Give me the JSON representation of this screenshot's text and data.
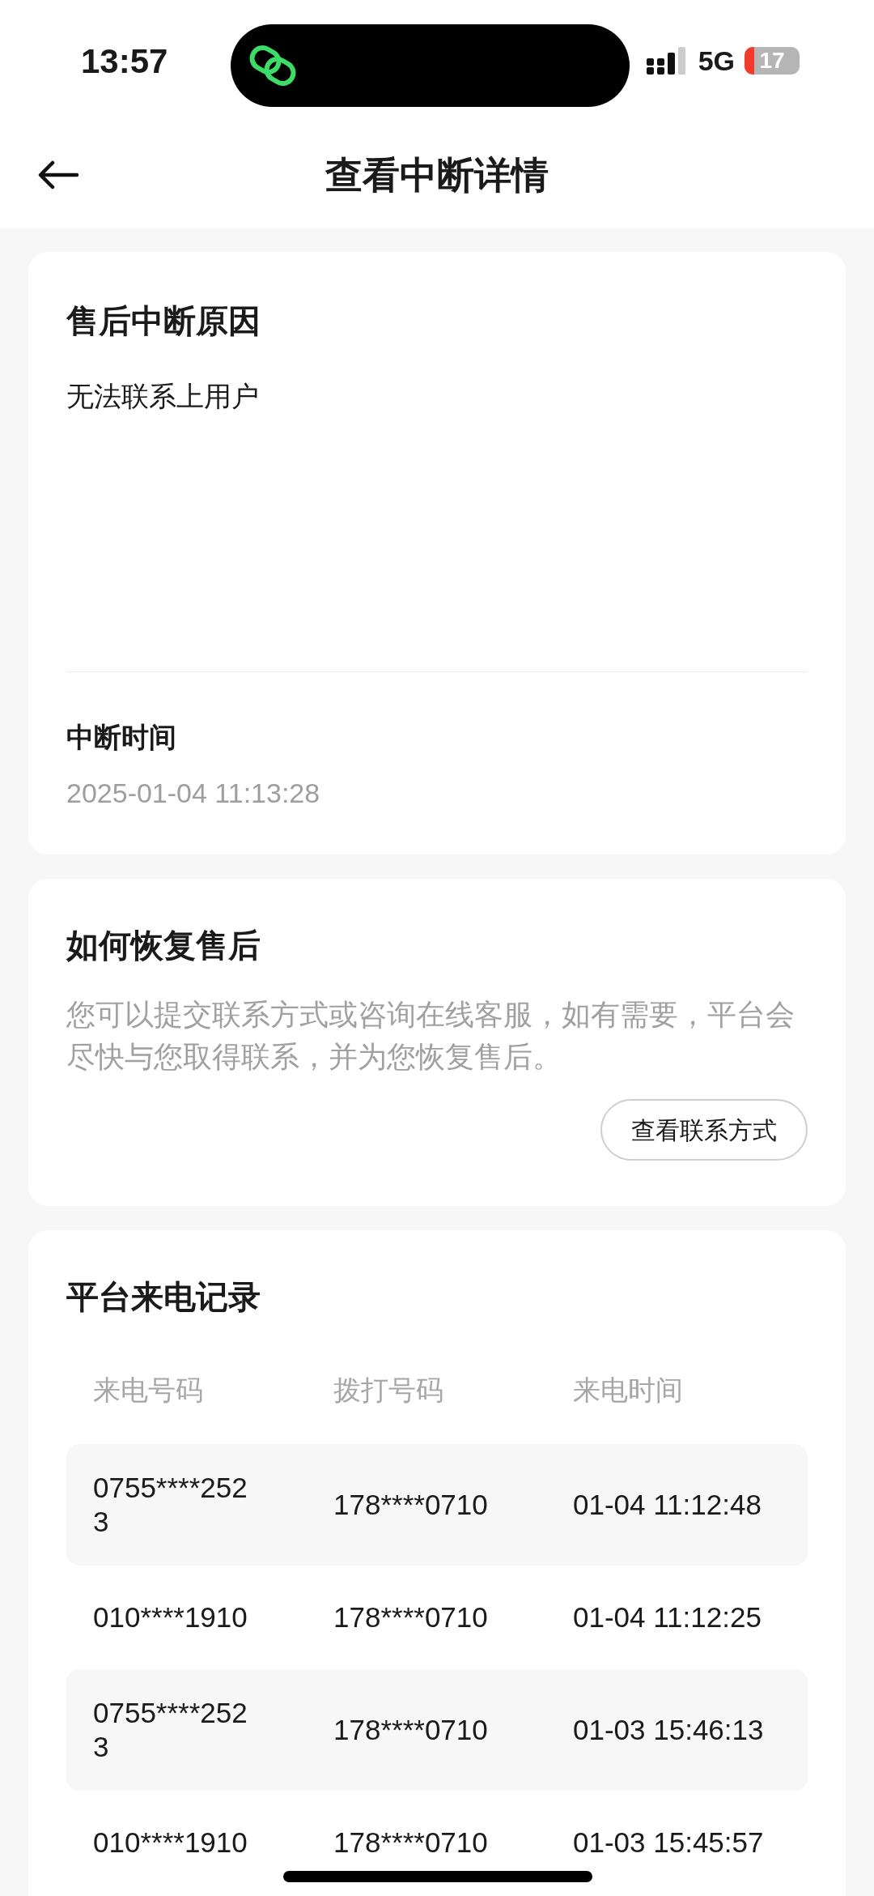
{
  "status_bar": {
    "time": "13:57",
    "network": "5G",
    "battery": "17"
  },
  "header": {
    "title": "查看中断详情"
  },
  "reason_card": {
    "title": "售后中断原因",
    "reason": "无法联系上用户",
    "time_label": "中断时间",
    "time_value": "2025-01-04 11:13:28"
  },
  "recover_card": {
    "title": "如何恢复售后",
    "description": "您可以提交联系方式或咨询在线客服，如有需要，平台会尽快与您取得联系，并为您恢复售后。",
    "button": "查看联系方式"
  },
  "calls_card": {
    "title": "平台来电记录",
    "columns": [
      "来电号码",
      "拨打号码",
      "来电时间"
    ],
    "rows": [
      {
        "caller": "0755****2523",
        "dialed": "178****0710",
        "time": "01-04 11:12:48"
      },
      {
        "caller": "010****1910",
        "dialed": "178****0710",
        "time": "01-04 11:12:25"
      },
      {
        "caller": "0755****2523",
        "dialed": "178****0710",
        "time": "01-03 15:46:13"
      },
      {
        "caller": "010****1910",
        "dialed": "178****0710",
        "time": "01-03 15:45:57"
      }
    ]
  }
}
